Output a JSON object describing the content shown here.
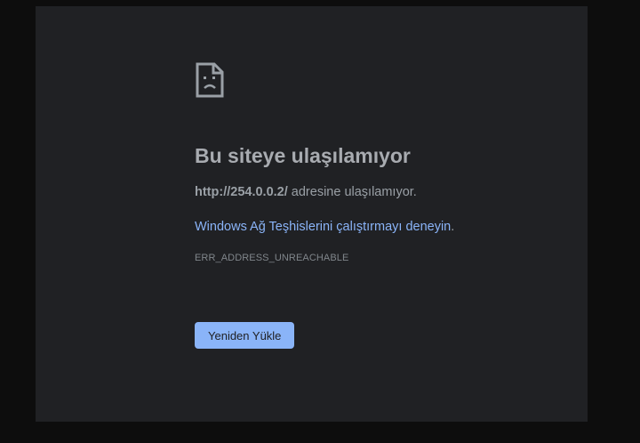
{
  "error": {
    "icon": "sad-page-icon",
    "title": "Bu siteye ulaşılamıyor",
    "url": "http://254.0.0.2/",
    "url_suffix": " adresine ulaşılamıyor.",
    "suggestion_link": "Windows Ağ Teşhislerini çalıştırmayı deneyin",
    "suggestion_suffix": ".",
    "code": "ERR_ADDRESS_UNREACHABLE",
    "reload_label": "Yeniden Yükle"
  },
  "colors": {
    "page_background": "#202124",
    "outer_background": "#0d0d0d",
    "link": "#8ab4f8",
    "button": "#8ab4f8",
    "title_text": "#a8abb0",
    "body_text": "#9aa0a6"
  }
}
